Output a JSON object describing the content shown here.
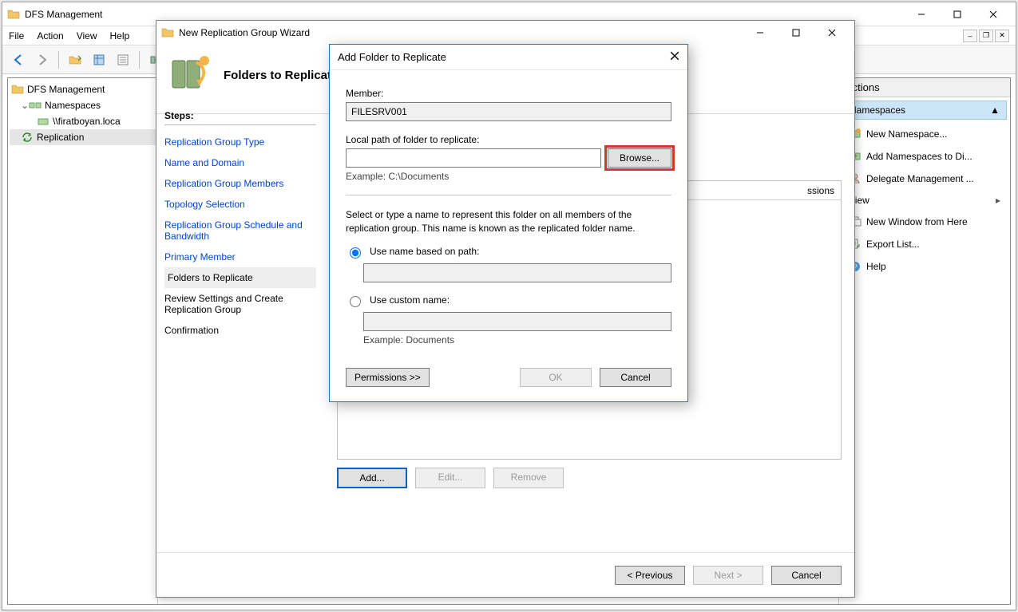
{
  "main": {
    "title": "DFS Management",
    "menu": {
      "file": "File",
      "action": "Action",
      "view": "View",
      "help": "Help"
    },
    "tree": {
      "root": "DFS Management",
      "namespaces": "Namespaces",
      "ns_item": "\\\\firatboyan.loca",
      "replication": "Replication"
    }
  },
  "actions": {
    "header": "Actions",
    "section": "Namespaces",
    "items": {
      "new_ns": "New Namespace...",
      "add_ns": "Add Namespaces to Di...",
      "delegate": "Delegate Management ...",
      "view": "View",
      "new_win": "New Window from Here",
      "export": "Export List...",
      "help": "Help"
    }
  },
  "wizard": {
    "title": "New Replication Group Wizard",
    "heading": "Folders to Replicate",
    "steps_label": "Steps:",
    "steps": {
      "s1": "Replication Group Type",
      "s2": "Name and Domain",
      "s3": "Replication Group Members",
      "s4": "Topology Selection",
      "s5": "Replication Group Schedule and Bandwidth",
      "s6": "Primary Member",
      "s7": "Folders to Replicate",
      "s8": "Review Settings and Create Replication Group",
      "s9": "Confirmation"
    },
    "table": {
      "col_permissions": "ssions"
    },
    "buttons": {
      "add": "Add...",
      "edit": "Edit...",
      "remove": "Remove",
      "prev": "< Previous",
      "next": "Next >",
      "cancel": "Cancel"
    }
  },
  "dialog": {
    "title": "Add Folder to Replicate",
    "member_label": "Member:",
    "member_value": "FILESRV001",
    "path_label": "Local path of folder to replicate:",
    "path_value": "",
    "browse": "Browse...",
    "example_path": "Example: C:\\Documents",
    "name_desc": "Select or type a name to represent this folder on all members of the replication group. This name is known as the replicated folder name.",
    "radio_path": "Use name based on path:",
    "radio_custom": "Use custom name:",
    "example_doc": "Example: Documents",
    "permissions": "Permissions >>",
    "ok": "OK",
    "cancel": "Cancel"
  }
}
